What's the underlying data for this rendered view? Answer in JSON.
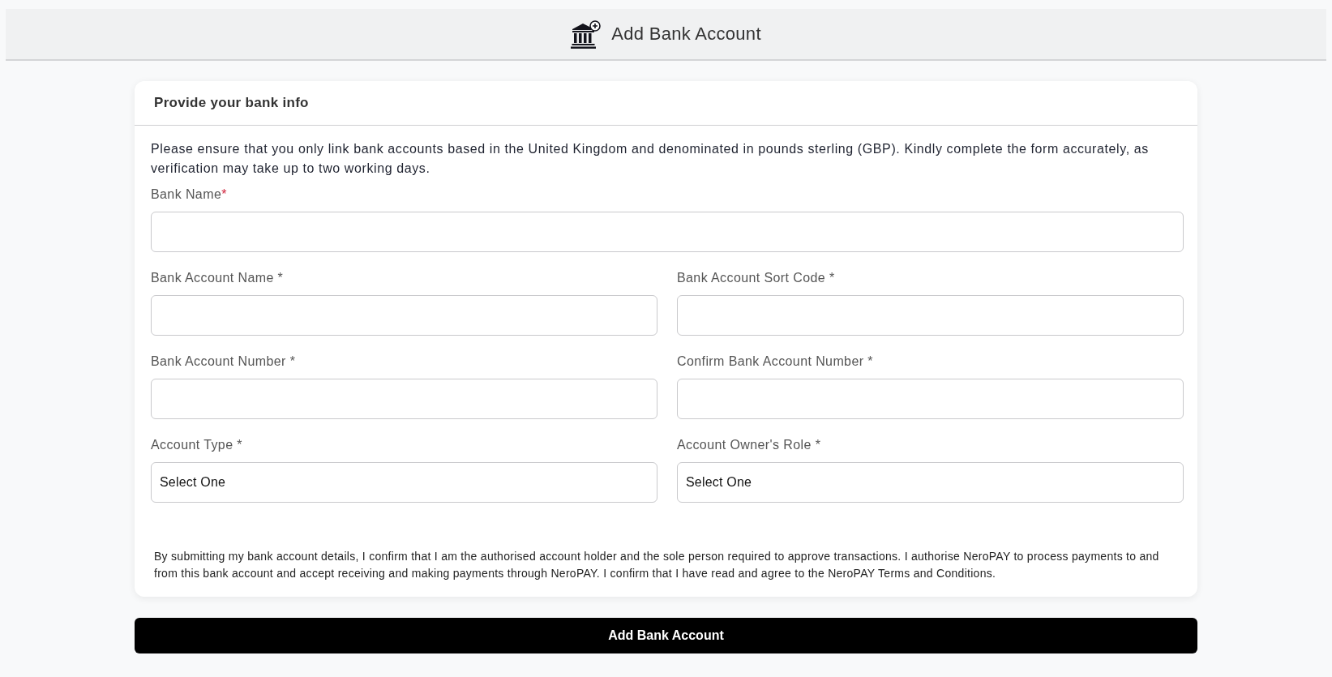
{
  "header": {
    "title": "Add Bank Account"
  },
  "card": {
    "title": "Provide your bank info",
    "intro": "Please ensure that you only link bank accounts based in the United Kingdom and denominated in pounds sterling (GBP). Kindly complete the form accurately, as verification may take up to two working days.",
    "rows": [
      [
        {
          "kind": "text",
          "label": "Bank Name",
          "required_mark": "*"
        }
      ],
      [
        {
          "kind": "text",
          "label": "Bank Account Name *"
        },
        {
          "kind": "text",
          "label": "Bank Account Sort Code *"
        }
      ],
      [
        {
          "kind": "text",
          "label": "Bank Account Number *"
        },
        {
          "kind": "text",
          "label": "Confirm Bank Account Number *"
        }
      ],
      [
        {
          "kind": "select",
          "label": "Account Type *",
          "value": "Select One"
        },
        {
          "kind": "select",
          "label": "Account Owner's Role *",
          "value": "Select One"
        }
      ]
    ],
    "consent": "By submitting my bank account details, I confirm that I am the authorised account holder and the sole person required to approve transactions. I authorise NeroPAY to process payments to and from this bank account and accept receiving and making payments through NeroPAY. I confirm that I have read and agree to the NeroPAY Terms and Conditions."
  },
  "submit_button": {
    "label": "Add Bank Account"
  }
}
